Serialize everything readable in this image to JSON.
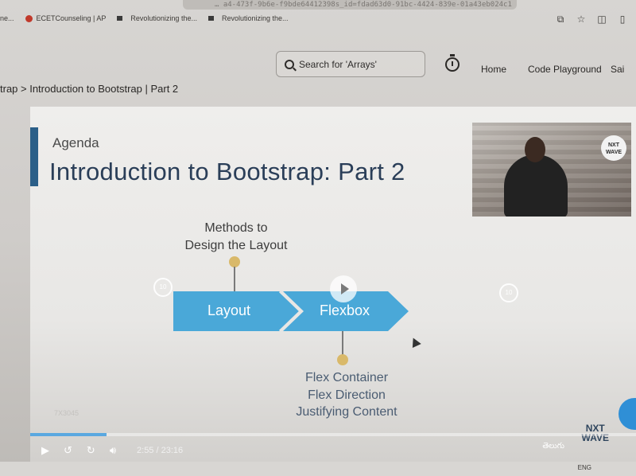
{
  "browser": {
    "url_fragment": "… a4-473f-9b6e-f9bde64412398s_id=fdad63d0-91bc-4424-839e-01a43eb024c1",
    "bookmarks": [
      {
        "label": "ECETCounseling | AP"
      },
      {
        "label": "Revolutionizing the..."
      },
      {
        "label": "Revolutionizing the..."
      }
    ],
    "left_cutoff": "ne..."
  },
  "header": {
    "search_placeholder": "Search for 'Arrays'",
    "nav": [
      "Home",
      "Code Playground",
      "Sai"
    ]
  },
  "breadcrumb": "trap > Introduction to Bootstrap | Part 2",
  "slide": {
    "agenda_label": "Agenda",
    "title": "Introduction to Bootstrap: Part 2",
    "methods_label_line1": "Methods to",
    "methods_label_line2": "Design the Layout",
    "arrow_labels": [
      "Layout",
      "Flexbox"
    ],
    "flex_notes": [
      "Flex Container",
      "Flex Direction",
      "Justifying Content"
    ],
    "watermark": "7X3045",
    "skip_back": "10",
    "skip_forward": "10",
    "webcam_badge": "NXT WAVE",
    "logo_line1": "NXT",
    "logo_line2": "WAVE"
  },
  "player": {
    "time": "2:55 / 23:16",
    "progress_fraction": 0.126,
    "language": "తెలుగు"
  },
  "taskbar": {
    "language": "ENG"
  },
  "colors": {
    "arrow_blue": "#4aa8d8",
    "title_navy": "#2a3e58",
    "accent_bar": "#2b5f88",
    "pin_gold": "#d9b96a"
  }
}
